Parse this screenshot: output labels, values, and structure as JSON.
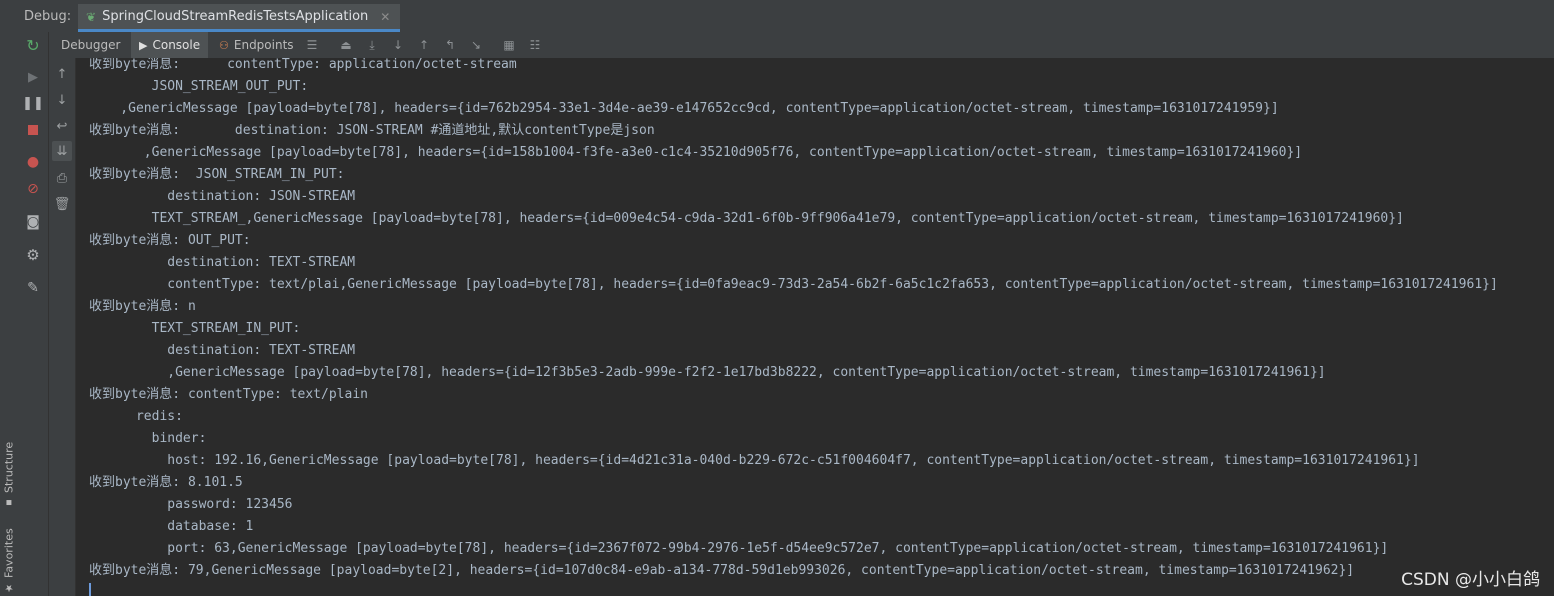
{
  "header": {
    "debug_label": "Debug:",
    "run_tab_label": "SpringCloudStreamRedisTestsApplication",
    "run_tab_close": "✕"
  },
  "tool_stripe": {
    "structure_label": "Structure",
    "favorites_label": "Favorites"
  },
  "subtabs": {
    "debugger": "Debugger",
    "console": "Console",
    "endpoints": "Endpoints"
  },
  "colors": {
    "background": "#2b2b2b",
    "text": "#a9b7c6",
    "accent": "#4a88c7",
    "stop_red": "#c75450",
    "resume_green": "#59a869"
  },
  "icons": {
    "rerun": "rerun-icon",
    "resume": "resume-icon",
    "pause": "pause-icon",
    "stop": "stop-icon",
    "view_breakpoints": "view-breakpoints-icon",
    "mute_breakpoints": "mute-breakpoints-icon",
    "screenshot": "camera-icon",
    "settings": "gear-icon",
    "pin": "pin-icon"
  },
  "console": {
    "lines": [
      "收到byte消息:      contentType: application/octet-stream",
      "        JSON_STREAM_OUT_PUT:",
      "    ,GenericMessage [payload=byte[78], headers={id=762b2954-33e1-3d4e-ae39-e147652cc9cd, contentType=application/octet-stream, timestamp=1631017241959}]",
      "收到byte消息:       destination: JSON-STREAM #通道地址,默认contentType是json",
      "       ,GenericMessage [payload=byte[78], headers={id=158b1004-f3fe-a3e0-c1c4-35210d905f76, contentType=application/octet-stream, timestamp=1631017241960}]",
      "收到byte消息:  JSON_STREAM_IN_PUT:",
      "          destination: JSON-STREAM",
      "        TEXT_STREAM_,GenericMessage [payload=byte[78], headers={id=009e4c54-c9da-32d1-6f0b-9ff906a41e79, contentType=application/octet-stream, timestamp=1631017241960}]",
      "收到byte消息: OUT_PUT:",
      "          destination: TEXT-STREAM",
      "          contentType: text/plai,GenericMessage [payload=byte[78], headers={id=0fa9eac9-73d3-2a54-6b2f-6a5c1c2fa653, contentType=application/octet-stream, timestamp=1631017241961}]",
      "收到byte消息: n",
      "        TEXT_STREAM_IN_PUT:",
      "          destination: TEXT-STREAM",
      "          ,GenericMessage [payload=byte[78], headers={id=12f3b5e3-2adb-999e-f2f2-1e17bd3b8222, contentType=application/octet-stream, timestamp=1631017241961}]",
      "收到byte消息: contentType: text/plain",
      "      redis:",
      "        binder:",
      "          host: 192.16,GenericMessage [payload=byte[78], headers={id=4d21c31a-040d-b229-672c-c51f004604f7, contentType=application/octet-stream, timestamp=1631017241961}]",
      "收到byte消息: 8.101.5",
      "          password: 123456",
      "          database: 1",
      "          port: 63,GenericMessage [payload=byte[78], headers={id=2367f072-99b4-2976-1e5f-d54ee9c572e7, contentType=application/octet-stream, timestamp=1631017241961}]",
      "收到byte消息: 79,GenericMessage [payload=byte[2], headers={id=107d0c84-e9ab-a134-778d-59d1eb993026, contentType=application/octet-stream, timestamp=1631017241962}]"
    ]
  },
  "watermark": "CSDN @小小白鸽"
}
